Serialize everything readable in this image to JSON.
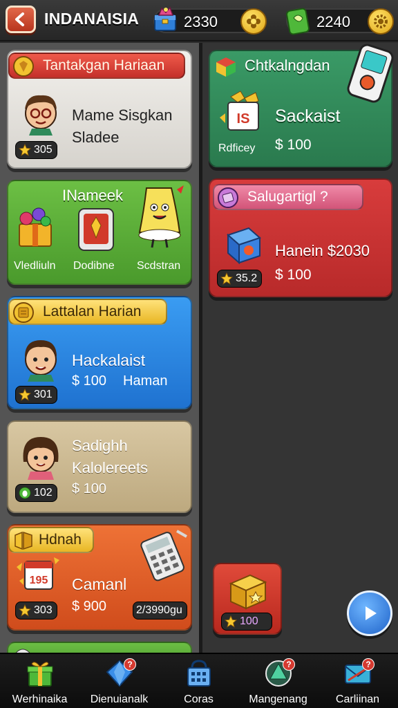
{
  "header": {
    "title": "INDANAISIA",
    "currency_1": {
      "icon": "toolbox-icon",
      "amount": "2330"
    },
    "currency_2": {
      "icon": "green-gem-icon",
      "amount": "2240"
    }
  },
  "left_cards": [
    {
      "ribbon": "Tantakgan Hariaan",
      "line1": "Mame Sisgkan",
      "line2": "Sladee",
      "badge": "305",
      "color": "#e6e4e0"
    },
    {
      "title": "INameek",
      "items": [
        "Vledliuln",
        "Dodibne",
        "Scdstran"
      ],
      "color": "#5aa63a"
    },
    {
      "ribbon": "Lattalan Harian",
      "line1": "Hackalaist",
      "line2": "$ 100",
      "line3": "Haman",
      "badge": "301",
      "color": "#2f8be6"
    },
    {
      "line1": "Sadighh",
      "line2": "Kalolereets",
      "line3": "$ 100",
      "badge": "102",
      "color": "#cbb995"
    },
    {
      "ribbon": "Hdnah",
      "line1": "Camanl",
      "line2": "$ 900",
      "badge": "303",
      "counter": "2/3990gu",
      "color": "#e2612a"
    }
  ],
  "right_cards": [
    {
      "ribbon": "Chtkalngdan",
      "line1": "Sackaist",
      "label": "Rdficey",
      "price": "$ 100",
      "color": "#2f8a5a"
    },
    {
      "ribbon": "Salugartigl ?",
      "line1": "Hanein $2030",
      "price": "$ 100",
      "badge": "35.2",
      "color": "#cc3434"
    }
  ],
  "chest": {
    "badge": "100"
  },
  "bottom_nav": [
    {
      "label": "Werhinaika",
      "icon": "gift-box-icon"
    },
    {
      "label": "Dienuianalk",
      "icon": "blue-gem-icon",
      "notif": "?"
    },
    {
      "label": "Coras",
      "icon": "shop-basket-icon"
    },
    {
      "label": "Mangenang",
      "icon": "green-orb-icon",
      "notif": "?"
    },
    {
      "label": "Carliinan",
      "icon": "mail-icon",
      "notif": "?"
    }
  ],
  "colors": {
    "header_bg": "#2c2c2c",
    "left_column": "#545454",
    "right_column": "#343434",
    "green_card": "#5aa63a",
    "blue_card": "#2f8be6",
    "orange_card": "#e2612a",
    "red_card": "#cc3434",
    "teal_card": "#2f8a5a",
    "gold": "#f2c230"
  }
}
